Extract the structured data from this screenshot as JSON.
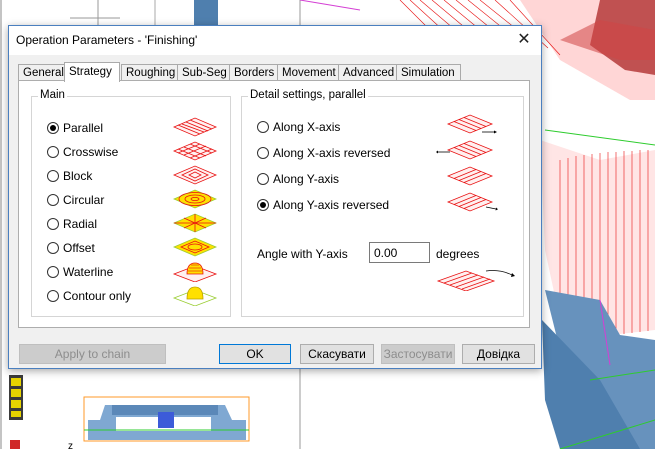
{
  "dialog": {
    "title": "Operation Parameters - 'Finishing'",
    "close_glyph": "✕"
  },
  "tabs": [
    {
      "label": "General",
      "active": false
    },
    {
      "label": "Strategy",
      "active": true
    },
    {
      "label": "Roughing",
      "active": false
    },
    {
      "label": "Sub-Seg",
      "active": false
    },
    {
      "label": "Borders",
      "active": false
    },
    {
      "label": "Movement",
      "active": false
    },
    {
      "label": "Advanced",
      "active": false
    },
    {
      "label": "Simulation",
      "active": false
    }
  ],
  "main": {
    "title": "Main",
    "options": [
      {
        "label": "Parallel",
        "selected": true,
        "icon": "parallel-pattern-icon"
      },
      {
        "label": "Crosswise",
        "selected": false,
        "icon": "crosswise-pattern-icon"
      },
      {
        "label": "Block",
        "selected": false,
        "icon": "block-pattern-icon"
      },
      {
        "label": "Circular",
        "selected": false,
        "icon": "circular-pattern-icon"
      },
      {
        "label": "Radial",
        "selected": false,
        "icon": "radial-pattern-icon"
      },
      {
        "label": "Offset",
        "selected": false,
        "icon": "offset-pattern-icon"
      },
      {
        "label": "Waterline",
        "selected": false,
        "icon": "waterline-pattern-icon"
      },
      {
        "label": "Contour only",
        "selected": false,
        "icon": "contour-pattern-icon"
      }
    ]
  },
  "detail": {
    "title": "Detail settings, parallel",
    "options": [
      {
        "label": "Along X-axis",
        "selected": false
      },
      {
        "label": "Along X-axis reversed",
        "selected": false
      },
      {
        "label": "Along Y-axis",
        "selected": false
      },
      {
        "label": "Along Y-axis reversed",
        "selected": true
      }
    ],
    "angle_label": "Angle with Y-axis",
    "angle_value": "0.00",
    "angle_unit": "degrees"
  },
  "buttons": {
    "apply_to_chain": "Apply to chain",
    "ok": "OK",
    "cancel": "Скасувати",
    "apply": "Застосувати",
    "help": "Довідка"
  },
  "colors": {
    "accent": "#0078d7",
    "toolpath_red": "#e81010",
    "pattern_yellow": "#ffe000",
    "pattern_green": "#9acd32",
    "model_blue": "#5a8ab8"
  }
}
